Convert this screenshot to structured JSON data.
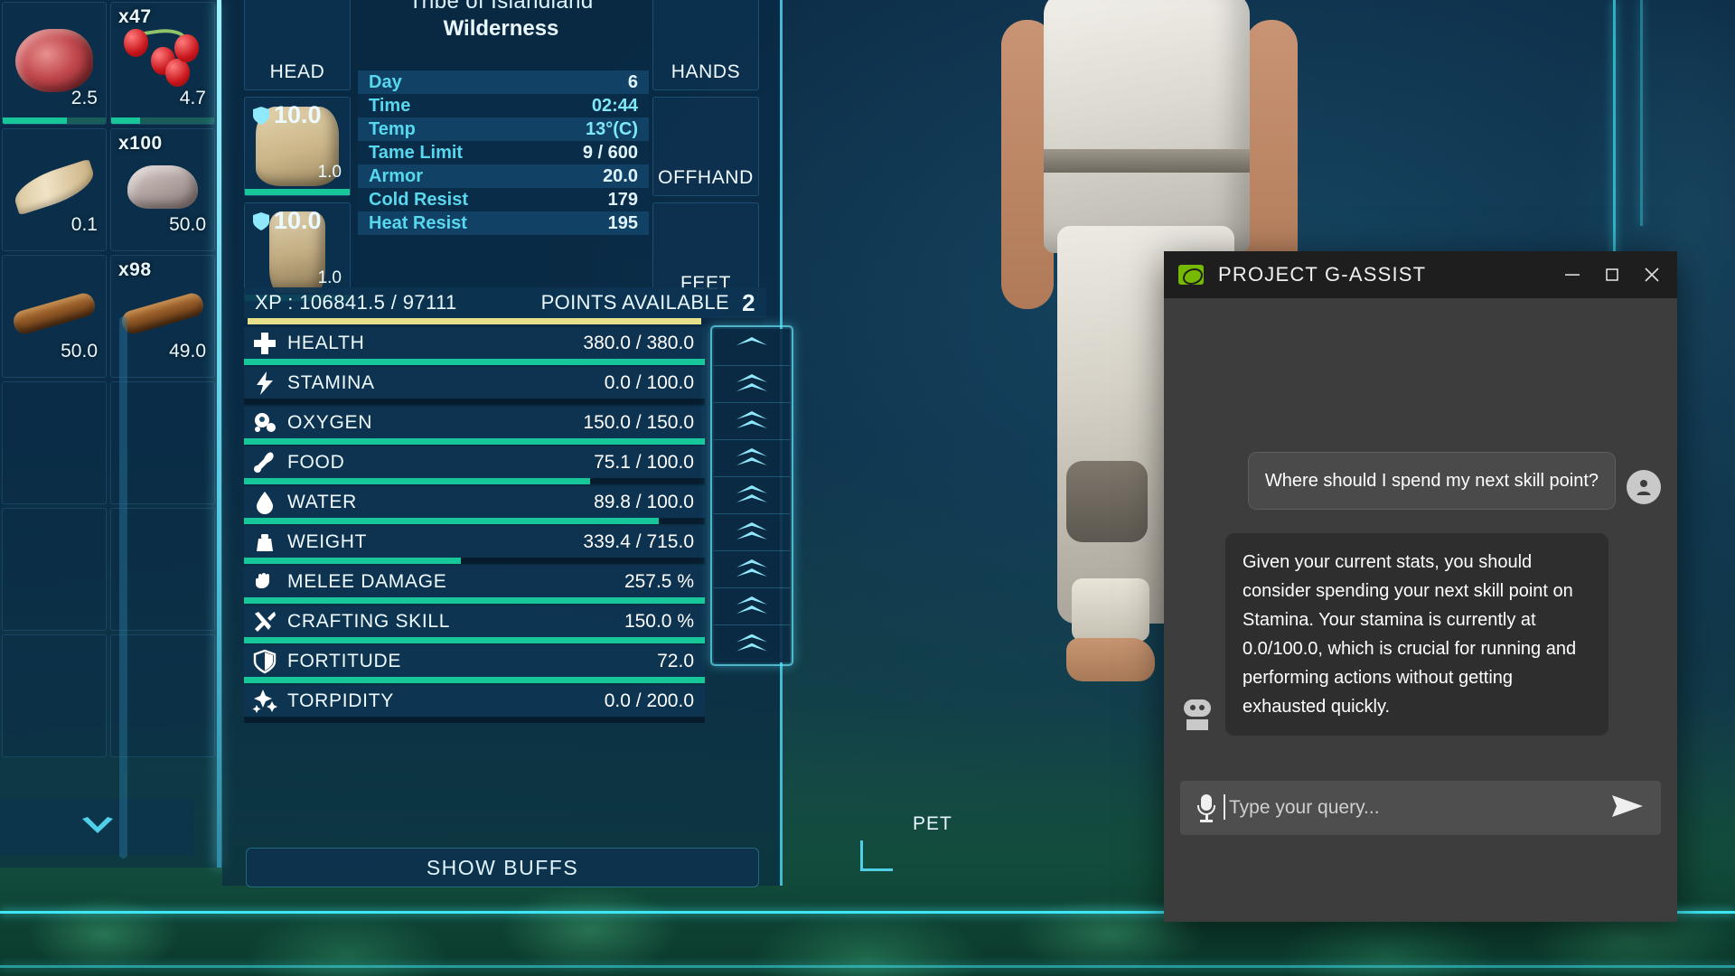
{
  "inventory": {
    "items": [
      {
        "qty": "",
        "weight": "2.5",
        "durability": 62,
        "art": "meat",
        "name": "raw-meat"
      },
      {
        "qty": "x47",
        "weight": "4.7",
        "durability": 28,
        "art": "berries",
        "name": "berries"
      },
      {
        "qty": "",
        "weight": "0.1",
        "durability": 0,
        "art": "feather",
        "name": "feather"
      },
      {
        "qty": "x100",
        "weight": "50.0",
        "durability": 0,
        "art": "stone",
        "name": "stone"
      },
      {
        "qty": "",
        "weight": "50.0",
        "durability": 0,
        "art": "wood",
        "name": "wood"
      },
      {
        "qty": "x98",
        "weight": "49.0",
        "durability": 0,
        "art": "wood",
        "name": "wood"
      }
    ],
    "scroll_down_icon": "chevron-down-icon"
  },
  "character": {
    "tribe": "Tribe of Islandland",
    "status": "Wilderness",
    "equipment_left": [
      {
        "label": "HEAD",
        "armor": "",
        "weight": "",
        "art": ""
      },
      {
        "label": "",
        "armor": "10.0",
        "weight": "1.0",
        "art": "shirt"
      },
      {
        "label": "",
        "armor": "10.0",
        "weight": "1.0",
        "art": "pants"
      }
    ],
    "equipment_right": [
      {
        "label": "HANDS",
        "armor": "",
        "weight": "",
        "art": ""
      },
      {
        "label": "OFFHAND",
        "armor": "",
        "weight": "",
        "art": ""
      },
      {
        "label": "FEET",
        "armor": "",
        "weight": "",
        "art": ""
      }
    ],
    "pet_label": "PET",
    "info": [
      {
        "label": "Day",
        "value": "6",
        "white": true
      },
      {
        "label": "Time",
        "value": "02:44",
        "white": false
      },
      {
        "label": "Temp",
        "value": "13°(C)",
        "white": false
      },
      {
        "label": "Tame Limit",
        "value": "9 / 600",
        "white": true
      },
      {
        "label": "Armor",
        "value": "20.0",
        "white": true
      },
      {
        "label": "Cold Resist",
        "value": "179",
        "white": true
      },
      {
        "label": "Heat Resist",
        "value": "195",
        "white": true
      }
    ]
  },
  "xp": {
    "label": "XP : 106841.5 / 97111",
    "points_label": "POINTS AVAILABLE",
    "points_value": "2",
    "bar_percent": 88,
    "bar_color": "#e7e08a"
  },
  "stats": [
    {
      "icon": "health-icon",
      "name": "HEALTH",
      "value": "380.0 / 380.0",
      "percent": 100,
      "upgradable": true
    },
    {
      "icon": "stamina-icon",
      "name": "STAMINA",
      "value": "0.0 / 100.0",
      "percent": 0,
      "upgradable": true
    },
    {
      "icon": "oxygen-icon",
      "name": "OXYGEN",
      "value": "150.0 / 150.0",
      "percent": 100,
      "upgradable": true
    },
    {
      "icon": "food-icon",
      "name": "FOOD",
      "value": "75.1 / 100.0",
      "percent": 75,
      "upgradable": true
    },
    {
      "icon": "water-icon",
      "name": "WATER",
      "value": "89.8 / 100.0",
      "percent": 90,
      "upgradable": true
    },
    {
      "icon": "weight-icon",
      "name": "WEIGHT",
      "value": "339.4 / 715.0",
      "percent": 47,
      "upgradable": true
    },
    {
      "icon": "melee-icon",
      "name": "MELEE DAMAGE",
      "value": "257.5 %",
      "percent": 100,
      "upgradable": true
    },
    {
      "icon": "crafting-icon",
      "name": "CRAFTING SKILL",
      "value": "150.0 %",
      "percent": 100,
      "upgradable": true
    },
    {
      "icon": "fortitude-icon",
      "name": "FORTITUDE",
      "value": "72.0",
      "percent": 100,
      "upgradable": true
    },
    {
      "icon": "torpidity-icon",
      "name": "TORPIDITY",
      "value": "0.0 / 200.0",
      "percent": 0,
      "upgradable": false
    }
  ],
  "show_buffs_label": "SHOW BUFFS",
  "gassist": {
    "title": "PROJECT G-ASSIST",
    "logo_icon": "nvidia-eye-icon",
    "minimize_icon": "minimize-icon",
    "maximize_icon": "maximize-icon",
    "close_icon": "close-icon",
    "messages": [
      {
        "role": "user",
        "avatar_icon": "user-avatar-icon",
        "text": "Where should I spend my next skill point?"
      },
      {
        "role": "bot",
        "avatar_icon": "robot-avatar-icon",
        "text": "Given your current stats, you should consider spending your next skill point on Stamina. Your stamina is currently at 0.0/100.0, which is crucial for running and performing actions without getting exhausted quickly."
      }
    ],
    "input": {
      "placeholder": "Type your query...",
      "value": "",
      "mic_icon": "microphone-icon",
      "send_icon": "send-icon"
    }
  },
  "colors": {
    "accent_cyan": "#4fd0e8",
    "stat_fill": "#17c79a",
    "xp_fill": "#e7e08a",
    "nvidia_green": "#76b900",
    "panel_dark": "#3d3d3d"
  }
}
